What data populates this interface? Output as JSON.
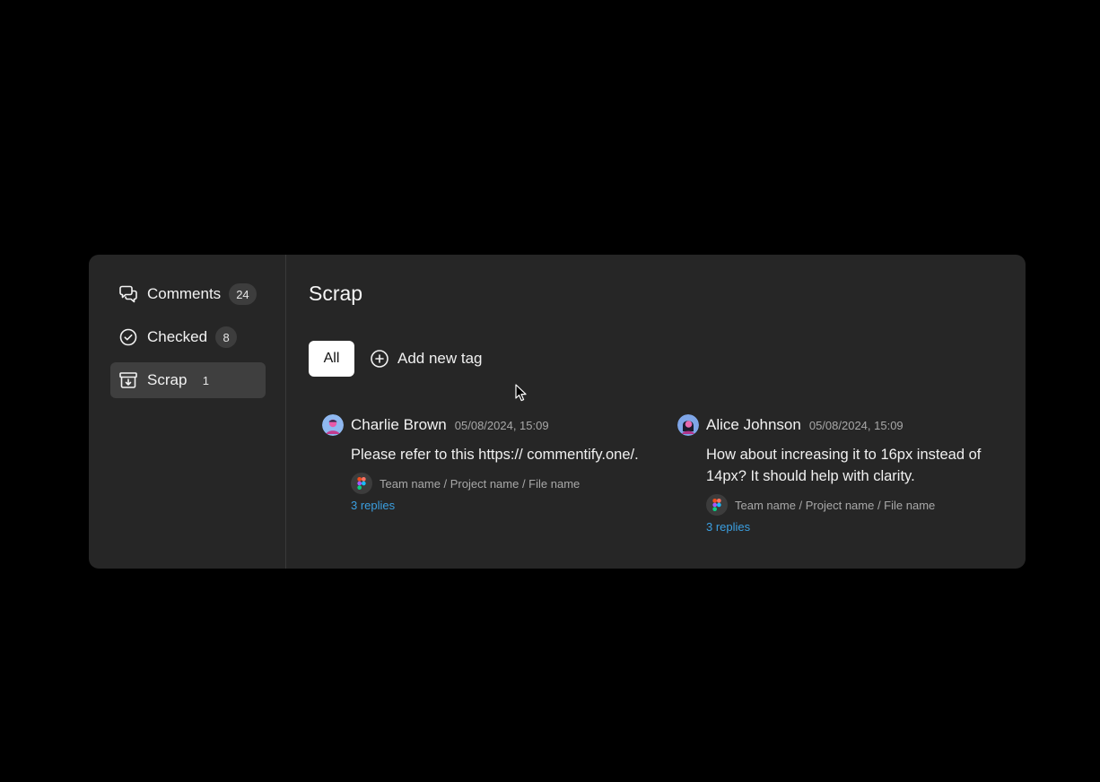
{
  "sidebar": {
    "items": [
      {
        "label": "Comments",
        "count": "24",
        "icon": "comments-icon"
      },
      {
        "label": "Checked",
        "count": "8",
        "icon": "check-circle-icon"
      },
      {
        "label": "Scrap",
        "count": "1",
        "icon": "archive-icon",
        "active": true
      }
    ]
  },
  "main": {
    "title": "Scrap",
    "tags": {
      "all_label": "All",
      "add_label": "Add new tag"
    },
    "comments": [
      {
        "author": "Charlie Brown",
        "timestamp": "05/08/2024, 15:09",
        "body": "Please refer to this https:// commentify.one/.",
        "path": "Team name / Project name / File name",
        "replies": "3 replies"
      },
      {
        "author": "Alice Johnson",
        "timestamp": "05/08/2024, 15:09",
        "body": "How about increasing it to 16px instead of 14px? It should help with clarity.",
        "path": "Team name / Project name / File name",
        "replies": "3 replies"
      }
    ]
  },
  "colors": {
    "background": "#000000",
    "panel": "#262626",
    "active_item": "#3f3f3f",
    "link": "#3b9fe0"
  }
}
